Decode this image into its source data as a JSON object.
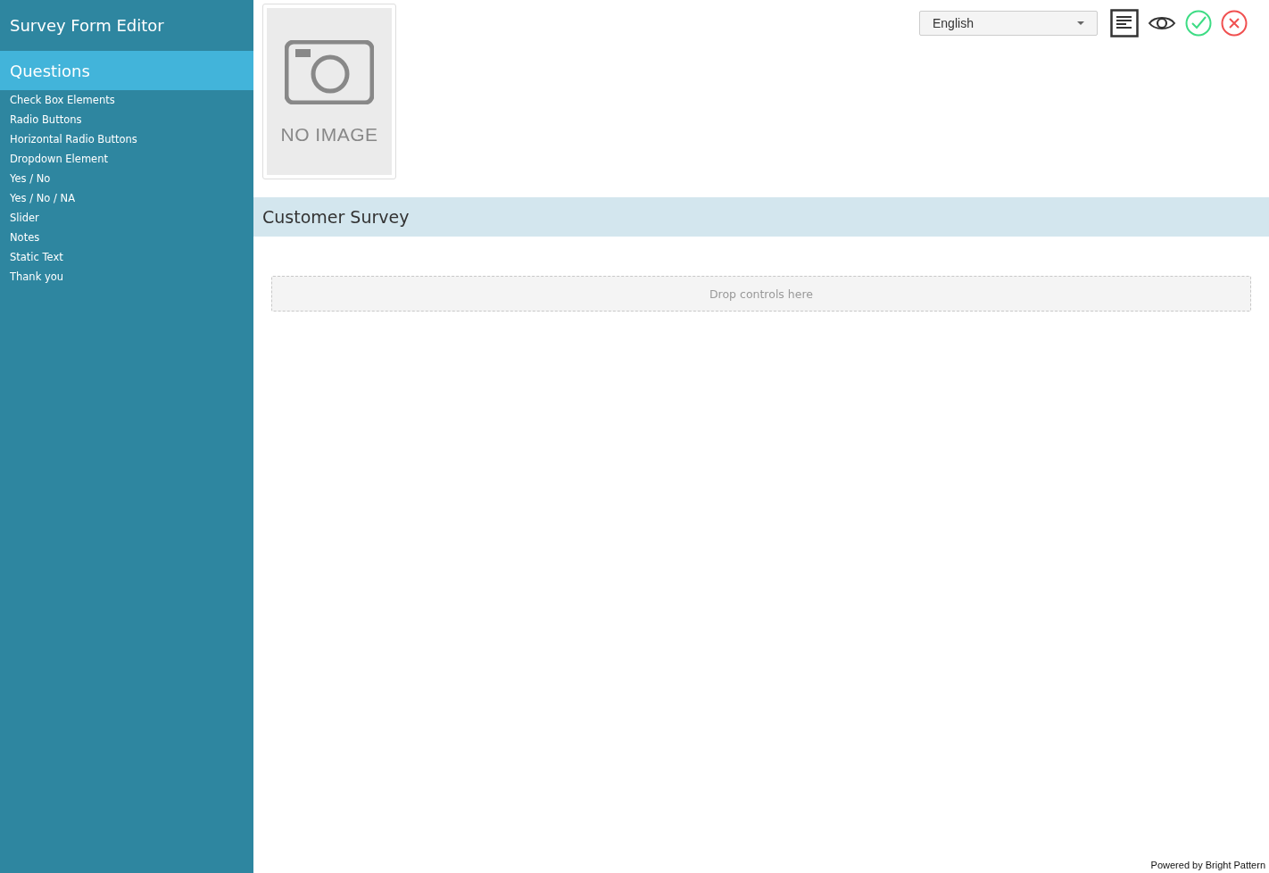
{
  "app": {
    "title": "Survey Form Editor"
  },
  "sidebar": {
    "heading": "Questions",
    "items": [
      {
        "label": "Check Box Elements"
      },
      {
        "label": "Radio Buttons"
      },
      {
        "label": "Horizontal Radio Buttons"
      },
      {
        "label": "Dropdown Element"
      },
      {
        "label": "Yes / No"
      },
      {
        "label": "Yes / No / NA"
      },
      {
        "label": "Slider"
      },
      {
        "label": "Notes"
      },
      {
        "label": "Static Text"
      },
      {
        "label": "Thank you"
      }
    ]
  },
  "logo_placeholder": {
    "caption": "NO IMAGE"
  },
  "toolbar": {
    "language": {
      "value": "English"
    }
  },
  "form": {
    "title": "Customer Survey",
    "drop_zone": "Drop controls here"
  },
  "footer": {
    "text": "Powered by Bright Pattern"
  }
}
